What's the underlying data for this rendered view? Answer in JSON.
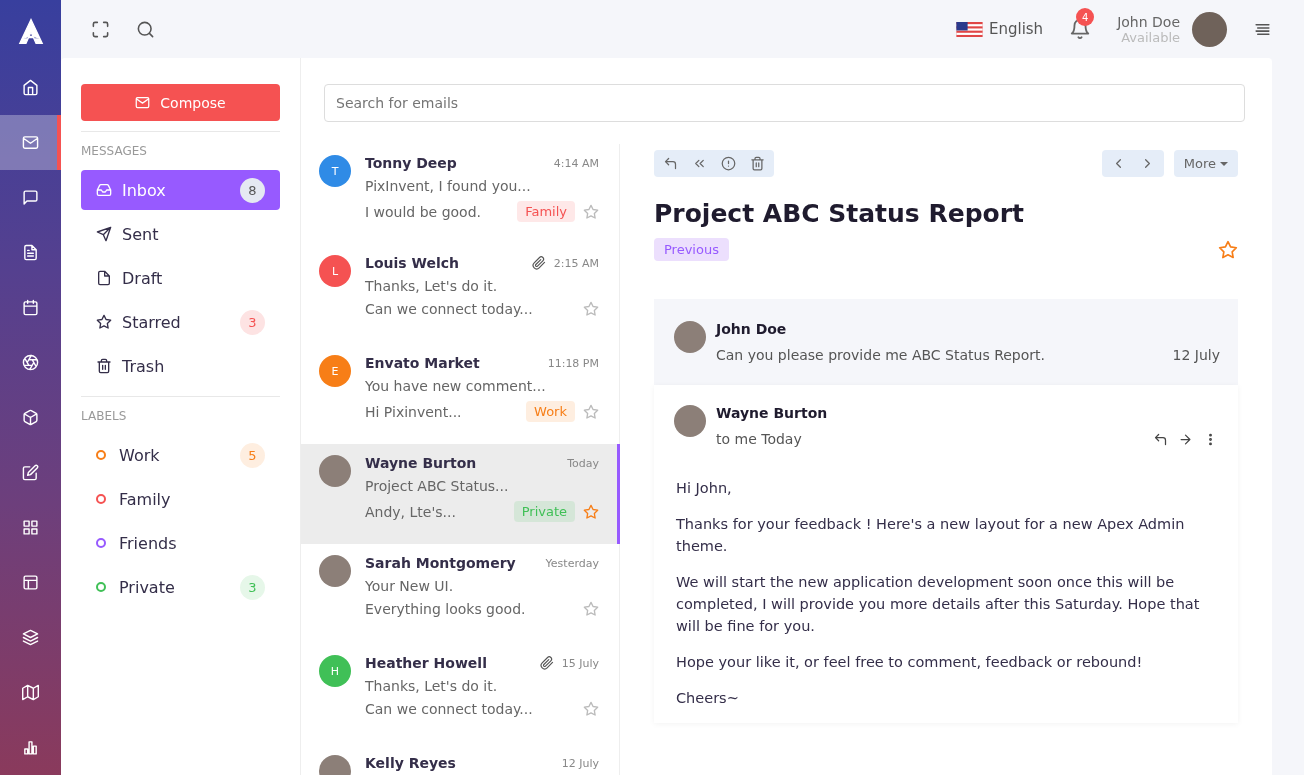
{
  "sidebar": {
    "items": [
      {
        "selected": false
      },
      {
        "selected": true
      },
      {
        "selected": false
      },
      {
        "selected": false
      },
      {
        "selected": false
      },
      {
        "selected": false
      },
      {
        "selected": false
      },
      {
        "selected": false
      },
      {
        "selected": false
      },
      {
        "selected": false
      },
      {
        "selected": false
      },
      {
        "selected": false
      },
      {
        "selected": false
      }
    ]
  },
  "topbar": {
    "language": "English",
    "notifications": "4",
    "user": {
      "name": "John Doe",
      "status": "Available"
    }
  },
  "compose": "Compose",
  "messages_title": "MESSAGES",
  "folders": [
    {
      "label": "Inbox",
      "count": "8",
      "selected": true
    },
    {
      "label": "Sent",
      "selected": false
    },
    {
      "label": "Draft",
      "selected": false
    },
    {
      "label": "Starred",
      "count": "3",
      "selected": false
    },
    {
      "label": "Trash",
      "selected": false
    }
  ],
  "labels_title": "LABELS",
  "labels": [
    {
      "label": "Work",
      "color": "#f77e17",
      "count": "5"
    },
    {
      "label": "Family",
      "color": "#f55252"
    },
    {
      "label": "Friends",
      "color": "#975aff"
    },
    {
      "label": "Private",
      "color": "#40c057",
      "count": "3"
    }
  ],
  "search": {
    "placeholder": "Search for emails"
  },
  "mails": [
    {
      "sender": "Tonny Deep",
      "avatar": {
        "kind": "initial",
        "text": "T",
        "color": "#2f8be6"
      },
      "time": "4:14 AM",
      "attachment": false,
      "subject": "PixInvent, I found you...",
      "preview": "I would be good.",
      "tag": {
        "label": "Family",
        "color": "#f55252"
      },
      "starred": false,
      "selected": false
    },
    {
      "sender": "Louis Welch",
      "avatar": {
        "kind": "initial",
        "text": "L",
        "color": "#f55252"
      },
      "time": "2:15 AM",
      "attachment": true,
      "subject": "Thanks, Let's do it.",
      "preview": "Can we connect today...",
      "starred": false,
      "selected": false
    },
    {
      "sender": "Envato Market",
      "avatar": {
        "kind": "initial",
        "text": "E",
        "color": "#f77e17"
      },
      "time": "11:18 PM",
      "attachment": false,
      "subject": "You have new comment...",
      "preview": "Hi Pixinvent...",
      "tag": {
        "label": "Work",
        "color": "#f77e17"
      },
      "starred": false,
      "selected": false
    },
    {
      "sender": "Wayne Burton",
      "avatar": {
        "kind": "photo"
      },
      "time": "Today",
      "attachment": false,
      "subject": "Project ABC Status...",
      "preview": "Andy, Lte's...",
      "tag": {
        "label": "Private",
        "color": "#40c057"
      },
      "starred": true,
      "selected": true
    },
    {
      "sender": "Sarah Montgomery",
      "avatar": {
        "kind": "photo"
      },
      "time": "Yesterday",
      "attachment": false,
      "subject": "Your New UI.",
      "preview": "Everything looks good.",
      "starred": false,
      "selected": false
    },
    {
      "sender": "Heather Howell",
      "avatar": {
        "kind": "initial",
        "text": "H",
        "color": "#40c057"
      },
      "time": "15 July",
      "attachment": true,
      "subject": "Thanks, Let's do it.",
      "preview": "Can we connect today...",
      "starred": false,
      "selected": false
    },
    {
      "sender": "Kelly Reyes",
      "avatar": {
        "kind": "photo"
      },
      "time": "12 July",
      "attachment": false,
      "selected": false
    }
  ],
  "detail": {
    "more": "More",
    "title": "Project ABC Status Report",
    "tag": "Previous",
    "starred": true,
    "thread": [
      {
        "kind": "summary",
        "sender": "John Doe",
        "text": "Can you please provide me ABC Status Report.",
        "date": "12 July"
      },
      {
        "kind": "full",
        "sender": "Wayne Burton",
        "meta": "to me Today",
        "paragraphs": [
          "Hi John,",
          "Thanks for your feedback ! Here's a new layout for a new Apex Admin theme.",
          "We will start the new application development soon once this will be completed, I will provide you more details after this Saturday. Hope that will be fine for you.",
          "Hope your like it, or feel free to comment, feedback or rebound!",
          "Cheers~"
        ]
      }
    ]
  }
}
